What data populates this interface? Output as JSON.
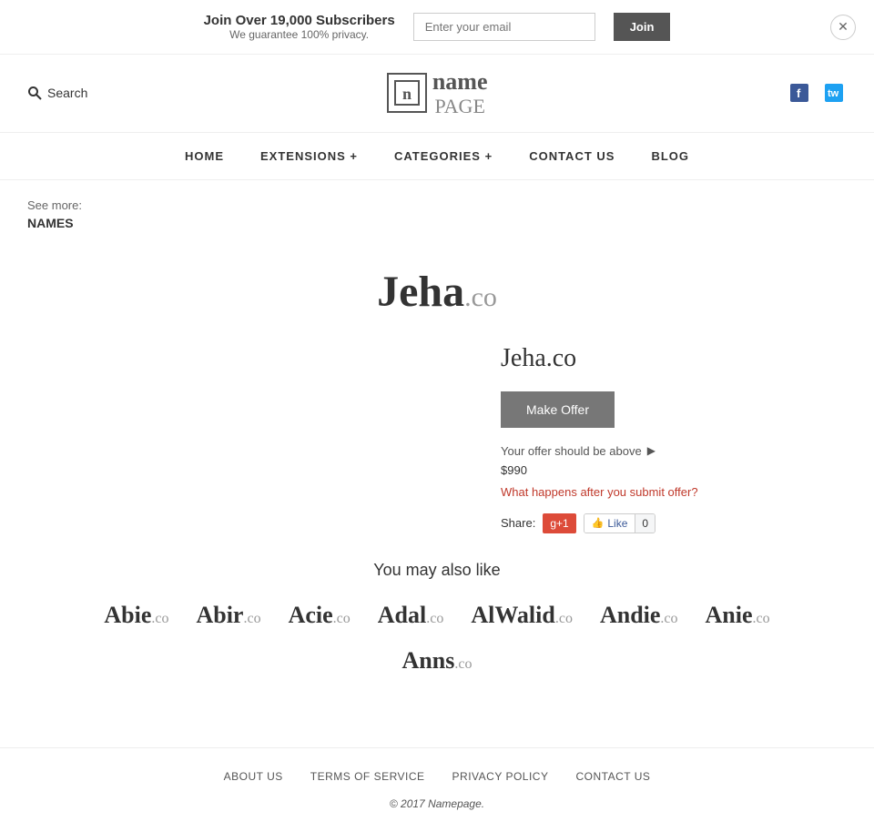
{
  "banner": {
    "title": "Join Over 19,000 Subscribers",
    "subtitle": "We guarantee 100% privacy.",
    "email_placeholder": "Enter your email",
    "join_label": "Join"
  },
  "header": {
    "search_label": "Search",
    "logo_icon": "n",
    "logo_name": "name",
    "logo_page": "PAGE",
    "facebook_icon": "f",
    "twitter_icon": "t"
  },
  "nav": {
    "items": [
      {
        "label": "HOME",
        "id": "home"
      },
      {
        "label": "EXTENSIONS +",
        "id": "extensions"
      },
      {
        "label": "CATEGORIES +",
        "id": "categories"
      },
      {
        "label": "CONTACT US",
        "id": "contact"
      },
      {
        "label": "BLOG",
        "id": "blog"
      }
    ]
  },
  "breadcrumb": {
    "see_more": "See more:",
    "link_label": "NAMES"
  },
  "domain": {
    "name": "Jeha",
    "tld": ".co",
    "full": "Jeha.co",
    "offer_button": "Make Offer",
    "offer_info": "Your offer should be above",
    "offer_price": "$990",
    "offer_link": "What happens after you submit offer?",
    "share_label": "Share:",
    "gplus_label": "g+1",
    "fb_like_label": "Like",
    "fb_count": "0"
  },
  "similar": {
    "title": "You may also like",
    "items_row1": [
      {
        "name": "Abie",
        "tld": ".co"
      },
      {
        "name": "Abir",
        "tld": ".co"
      },
      {
        "name": "Acie",
        "tld": ".co"
      },
      {
        "name": "Adal",
        "tld": ".co"
      },
      {
        "name": "AlWalid",
        "tld": ".co"
      },
      {
        "name": "Andie",
        "tld": ".co"
      },
      {
        "name": "Anie",
        "tld": ".co"
      }
    ],
    "items_row2": [
      {
        "name": "Anns",
        "tld": ".co"
      }
    ]
  },
  "footer": {
    "links": [
      {
        "label": "ABOUT US",
        "id": "about"
      },
      {
        "label": "TERMS OF SERVICE",
        "id": "terms"
      },
      {
        "label": "PRIVACY POLICY",
        "id": "privacy"
      },
      {
        "label": "CONTACT US",
        "id": "contact"
      }
    ],
    "copy": "© 2017",
    "brand": "Namepage."
  }
}
